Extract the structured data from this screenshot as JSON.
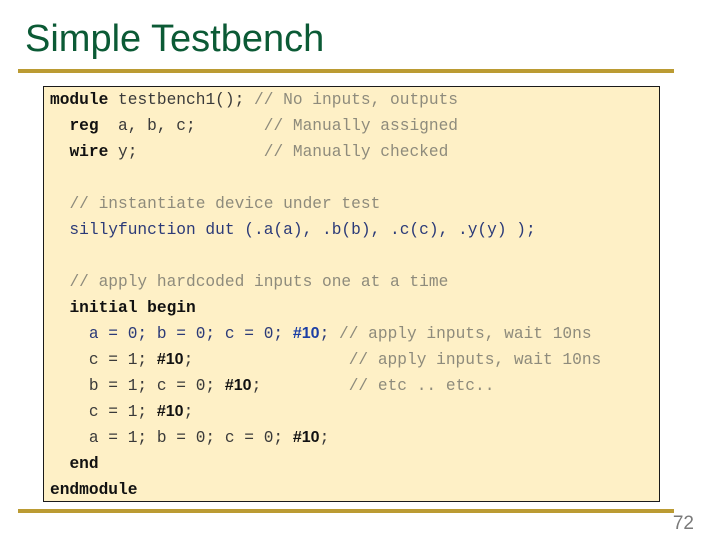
{
  "slide": {
    "title": "Simple Testbench",
    "page_number": "72",
    "colors": {
      "title": "#0b5a35",
      "rule": "#bb9b33",
      "code_background": "#fef0c6",
      "keyword": "#111111",
      "code": "#2b3a78",
      "comment": "#8e8b7c",
      "delay_highlight": "#1b3ea5"
    }
  },
  "code": {
    "lines": [
      [
        {
          "t": "kw",
          "text": "module"
        },
        {
          "t": "plain",
          "text": " testbench1(); "
        },
        {
          "t": "cm",
          "text": "// No inputs, outputs"
        }
      ],
      [
        {
          "t": "plain",
          "text": "  "
        },
        {
          "t": "kw",
          "text": "reg"
        },
        {
          "t": "plain",
          "text": "  a, b, c;       "
        },
        {
          "t": "cm",
          "text": "// Manually assigned"
        }
      ],
      [
        {
          "t": "plain",
          "text": "  "
        },
        {
          "t": "kw",
          "text": "wire"
        },
        {
          "t": "plain",
          "text": " y;             "
        },
        {
          "t": "cm",
          "text": "// Manually checked"
        }
      ],
      [],
      [
        {
          "t": "plain",
          "text": "  "
        },
        {
          "t": "cm",
          "text": "// instantiate device under test"
        }
      ],
      [
        {
          "t": "code",
          "text": "  sillyfunction dut (.a(a), .b(b), .c(c), .y(y) );"
        }
      ],
      [],
      [
        {
          "t": "plain",
          "text": "  "
        },
        {
          "t": "cm",
          "text": "// apply hardcoded inputs one at a time"
        }
      ],
      [
        {
          "t": "plain",
          "text": "  "
        },
        {
          "t": "kw",
          "text": "initial begin"
        }
      ],
      [
        {
          "t": "code",
          "text": "    a = 0; b = 0; c = 0; "
        },
        {
          "t": "delay-blue",
          "text": "#10"
        },
        {
          "t": "code",
          "text": "; "
        },
        {
          "t": "cm",
          "text": "// apply inputs, wait 10ns"
        }
      ],
      [
        {
          "t": "plain",
          "text": "    c = 1; "
        },
        {
          "t": "delay",
          "text": "#10"
        },
        {
          "t": "plain",
          "text": ";                "
        },
        {
          "t": "cm",
          "text": "// apply inputs, wait 10ns"
        }
      ],
      [
        {
          "t": "plain",
          "text": "    b = 1; c = 0; "
        },
        {
          "t": "delay",
          "text": "#10"
        },
        {
          "t": "plain",
          "text": ";         "
        },
        {
          "t": "cm",
          "text": "// etc .. etc.."
        }
      ],
      [
        {
          "t": "plain",
          "text": "    c = 1; "
        },
        {
          "t": "delay",
          "text": "#10"
        },
        {
          "t": "plain",
          "text": ";"
        }
      ],
      [
        {
          "t": "plain",
          "text": "    a = 1; b = 0; c = 0; "
        },
        {
          "t": "delay",
          "text": "#10"
        },
        {
          "t": "plain",
          "text": ";"
        }
      ],
      [
        {
          "t": "plain",
          "text": "  "
        },
        {
          "t": "kw",
          "text": "end"
        }
      ],
      [
        {
          "t": "kw",
          "text": "endmodule"
        }
      ]
    ]
  }
}
